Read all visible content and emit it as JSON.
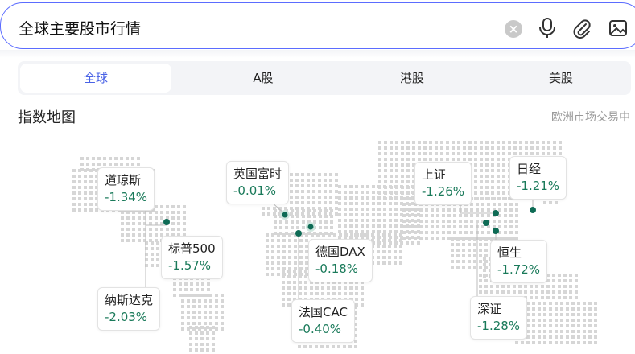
{
  "search": {
    "query": "全球主要股市行情",
    "clear_icon": "close-icon",
    "mic_icon": "microphone-icon",
    "attach_icon": "paperclip-icon",
    "image_icon": "image-icon"
  },
  "tabs": [
    {
      "label": "全球",
      "active": true
    },
    {
      "label": "A股",
      "active": false
    },
    {
      "label": "港股",
      "active": false
    },
    {
      "label": "美股",
      "active": false
    }
  ],
  "section": {
    "title": "指数地图",
    "status": "欧洲市场交易中"
  },
  "indices": [
    {
      "name": "道琼斯",
      "change": "-1.34%"
    },
    {
      "name": "标普500",
      "change": "-1.57%"
    },
    {
      "name": "纳斯达克",
      "change": "-2.03%"
    },
    {
      "name": "英国富时",
      "change": "-0.01%"
    },
    {
      "name": "德国DAX",
      "change": "-0.18%"
    },
    {
      "name": "法国CAC",
      "change": "-0.40%"
    },
    {
      "name": "上证",
      "change": "-1.26%"
    },
    {
      "name": "日经",
      "change": "-1.21%"
    },
    {
      "name": "恒生",
      "change": "-1.72%"
    },
    {
      "name": "深证",
      "change": "-1.28%"
    }
  ],
  "colors": {
    "accent": "#4a63e6",
    "change_text": "#1a7a5a",
    "marker": "#0e6b55",
    "map_dot": "#d6d6d6"
  }
}
